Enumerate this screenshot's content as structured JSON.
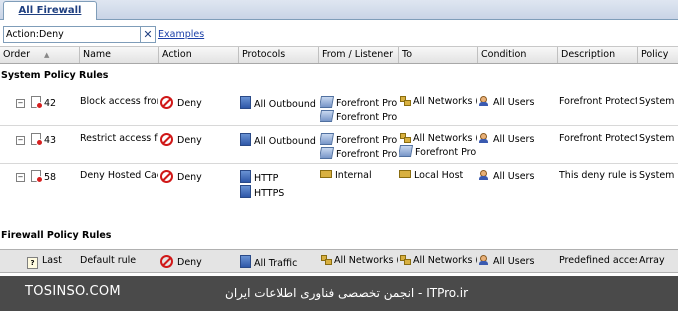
{
  "tab": {
    "label": "All Firewall Policy"
  },
  "search": {
    "value": "Action:Deny",
    "clear_symbol": "✕",
    "examples_link": "Examples"
  },
  "columns": [
    "Order",
    "Name",
    "Action",
    "Protocols",
    "From / Listener",
    "To",
    "Condition",
    "Description",
    "Policy"
  ],
  "groups": {
    "system": "System Policy Rules",
    "firewall": "Firewall Policy Rules"
  },
  "system_rules": [
    {
      "order": "42",
      "name": "Block access from...",
      "action": "Deny",
      "protocols": [
        "All Outbound ..."
      ],
      "from": [
        "Forefront Pro...",
        "Forefront Pro..."
      ],
      "to": [
        "All Networks (..."
      ],
      "condition": "All Users",
      "description": "Forefront Protect...",
      "policy": "System"
    },
    {
      "order": "43",
      "name": "Restrict access fr...",
      "action": "Deny",
      "protocols": [
        "All Outbound ..."
      ],
      "from": [
        "Forefront Pro...",
        "Forefront Pro..."
      ],
      "to": [
        "All Networks (...",
        "Forefront Pro..."
      ],
      "condition": "All Users",
      "description": "Forefront Protect...",
      "policy": "System"
    },
    {
      "order": "58",
      "name": "Deny Hosted Cac...",
      "action": "Deny",
      "protocols": [
        "HTTP",
        "HTTPS"
      ],
      "from": [
        "Internal"
      ],
      "to": [
        "Local Host"
      ],
      "condition": "All Users",
      "description": "This deny rule is r...",
      "policy": "System"
    }
  ],
  "firewall_rules": [
    {
      "order": "Last",
      "name": "Default rule",
      "action": "Deny",
      "protocols": [
        "All Traffic"
      ],
      "from": [
        "All Networks (..."
      ],
      "to": [
        "All Networks (..."
      ],
      "condition": "All Users",
      "description": "Predefined acces...",
      "policy": "Array"
    }
  ],
  "watermark": {
    "left": "TOSINSO.COM",
    "right": "ITPro.ir - انجمن تخصصی فناوری اطلاعات ایران"
  }
}
